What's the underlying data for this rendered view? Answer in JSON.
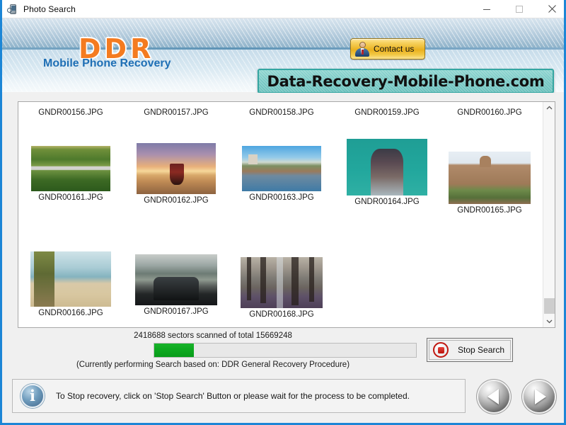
{
  "window": {
    "title": "Photo Search",
    "icon": "photo-search-icon",
    "minimize_label": "—",
    "maximize_label": "□",
    "close_label": "✕",
    "border_color": "#1c86d6"
  },
  "header": {
    "logo": "DDR",
    "logo_color": "#f47b20",
    "tagline": "Mobile Phone Recovery",
    "tagline_color": "#1e6fb5",
    "contact_button": "Contact us",
    "contact_icon": "user-avatar-icon",
    "url_banner": "Data-Recovery-Mobile-Phone.com",
    "url_banner_color": "#79c9c5"
  },
  "file_list": {
    "row0_captions": [
      "GNDR00156.JPG",
      "GNDR00157.JPG",
      "GNDR00158.JPG",
      "GNDR00159.JPG",
      "GNDR00160.JPG"
    ],
    "items": [
      {
        "caption": "GNDR00161.JPG",
        "thumb": "ph161"
      },
      {
        "caption": "GNDR00162.JPG",
        "thumb": "ph162"
      },
      {
        "caption": "GNDR00163.JPG",
        "thumb": "ph163"
      },
      {
        "caption": "GNDR00164.JPG",
        "thumb": "ph164"
      },
      {
        "caption": "GNDR00165.JPG",
        "thumb": "ph165"
      },
      {
        "caption": "GNDR00166.JPG",
        "thumb": "ph166"
      },
      {
        "caption": "GNDR00167.JPG",
        "thumb": "ph167"
      },
      {
        "caption": "GNDR00168.JPG",
        "thumb": "ph168"
      }
    ],
    "scrollbar": {
      "up_arrow": "∧",
      "down_arrow": "∨"
    }
  },
  "progress": {
    "status_text": "2418688 sectors scanned of total 15669248",
    "sectors_scanned": 2418688,
    "sectors_total": 15669248,
    "percent": 15,
    "fill_color": "#0da81f",
    "sub_text": "(Currently performing Search based on:  DDR General Recovery Procedure)",
    "stop_button": "Stop Search",
    "stop_icon": "stop-record-icon"
  },
  "footer": {
    "info_icon": "info-icon",
    "info_glyph": "i",
    "message": "To Stop recovery, click on 'Stop Search' Button or please wait for the process to be completed.",
    "prev_button_icon": "previous-arrow-icon",
    "next_button_icon": "next-arrow-icon"
  }
}
